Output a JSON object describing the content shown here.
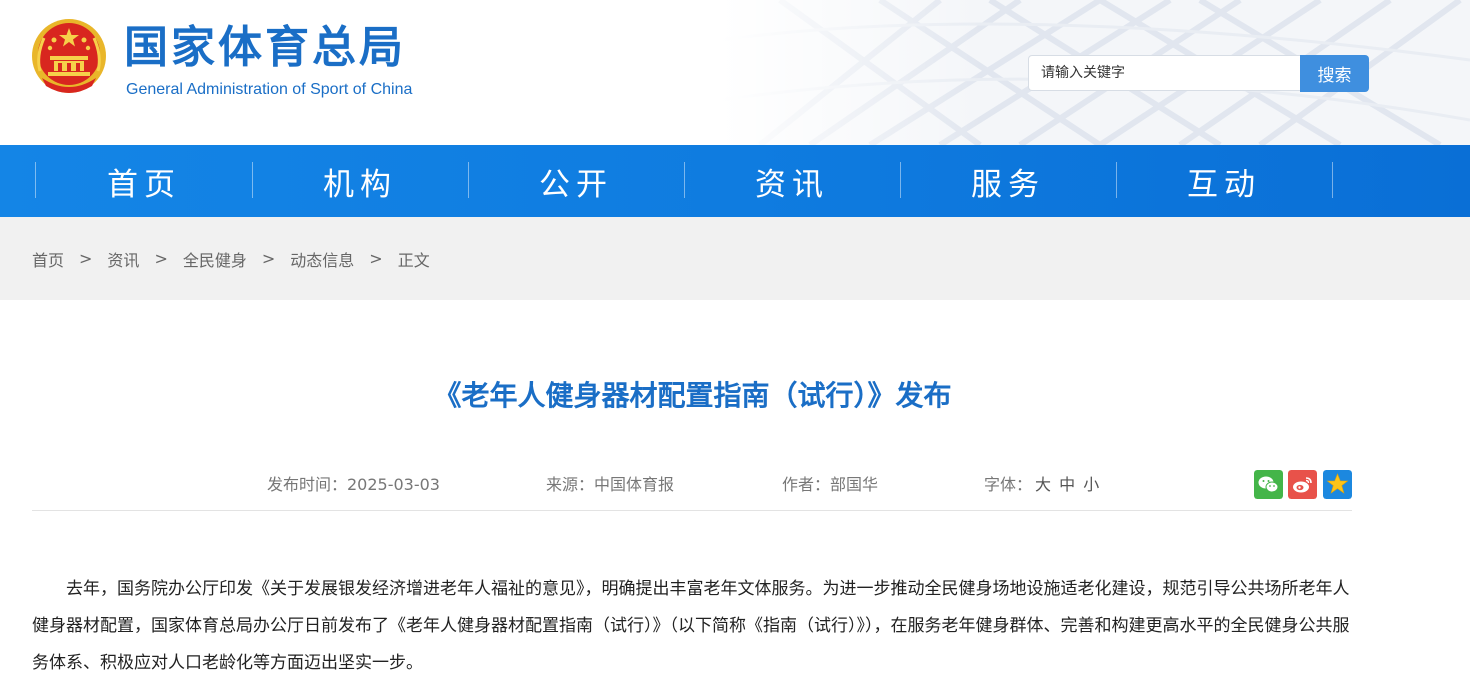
{
  "header": {
    "title_cn": "国家体育总局",
    "title_en": "General Administration of Sport of China",
    "emblem_icon": "national-emblem-icon"
  },
  "search": {
    "placeholder": "请输入关键字",
    "button_label": "搜索"
  },
  "nav": {
    "items": [
      {
        "label": "首页"
      },
      {
        "label": "机构"
      },
      {
        "label": "公开"
      },
      {
        "label": "资讯"
      },
      {
        "label": "服务"
      },
      {
        "label": "互动"
      }
    ]
  },
  "breadcrumb": {
    "items": [
      "首页",
      "资讯",
      "全民健身",
      "动态信息",
      "正文"
    ],
    "separator": ">"
  },
  "article": {
    "title": "《老年人健身器材配置指南（试行）》发布",
    "publish_time": "发布时间：2025-03-03",
    "source": "来源：中国体育报",
    "author": "作者：部国华",
    "font_size_label": "字体：",
    "font_large": "大",
    "font_medium": "中",
    "font_small": "小",
    "body": "去年，国务院办公厅印发《关于发展银发经济增进老年人福祉的意见》，明确提出丰富老年文体服务。为进一步推动全民健身场地设施适老化建设，规范引导公共场所老年人健身器材配置，国家体育总局办公厅日前发布了《老年人健身器材配置指南（试行）》（以下简称《指南（试行）》），在服务老年健身群体、完善和构建更高水平的全民健身公共服务体系、积极应对人口老龄化等方面迈出坚实一步。"
  },
  "share": {
    "icons": [
      "wechat-icon",
      "weibo-icon",
      "favorite-star-icon"
    ]
  },
  "colors": {
    "brand_blue": "#1a6ec6",
    "nav_blue": "#0f7ce0",
    "search_button": "#3f8fdf",
    "wechat_green": "#44b549",
    "weibo_red": "#e8524a",
    "star_blue": "#1c88df"
  }
}
